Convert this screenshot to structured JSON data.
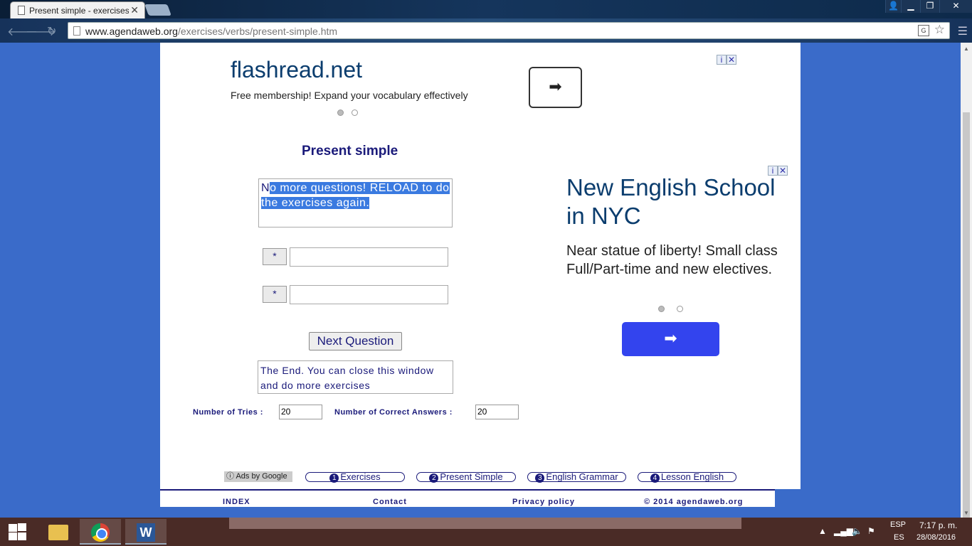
{
  "browser": {
    "tab_title": "Present simple - exercises",
    "tab_close": "✕",
    "url_domain": "www.agendaweb.org",
    "url_path": "/exercises/verbs/present-simple.htm",
    "window_controls": {
      "minimize": "▁",
      "restore": "❐",
      "close": "✕"
    }
  },
  "ads": {
    "top": {
      "title": "flashread.net",
      "text": "Free membership! Expand your vocabulary effectively",
      "arrow": "➡"
    },
    "right": {
      "title": "New English School in NYC",
      "text": "Near statue of liberty! Small class Full/Part-time and new electives.",
      "arrow": "➡"
    },
    "adchoice_info": "i",
    "adchoice_close": "✕"
  },
  "exercise": {
    "heading": "Present simple",
    "question_lead": "N",
    "question_selected": "o more questions!  RELOAD to do the exercises again.",
    "answers": [
      {
        "button": "*",
        "value": ""
      },
      {
        "button": "*",
        "value": ""
      }
    ],
    "next_button": "Next Question",
    "end_message": "The End. You can close this window and do more exercises",
    "tries_label": "Number of Tries :",
    "tries_value": "20",
    "correct_label": "Number of Correct Answers :",
    "correct_value": "20"
  },
  "footer": {
    "ads_by_google": "ⓘ Ads by Google",
    "links": [
      {
        "num": "1",
        "label": "Exercises"
      },
      {
        "num": "2",
        "label": "Present Simple"
      },
      {
        "num": "3",
        "label": "English Grammar"
      },
      {
        "num": "4",
        "label": "Lesson English"
      }
    ],
    "bottom": {
      "index": "INDEX",
      "contact": "Contact",
      "privacy": "Privacy policy",
      "copyright": "© 2014 agendaweb.org"
    }
  },
  "taskbar": {
    "language": "ESP",
    "locale": "ES",
    "time": "7:17 p. m.",
    "date": "28/08/2016"
  },
  "colors": {
    "page_bg": "#3a6bc9",
    "text_navy": "#1a1a7a",
    "ad_button": "#3344ee",
    "selection": "#3a7ae0"
  }
}
